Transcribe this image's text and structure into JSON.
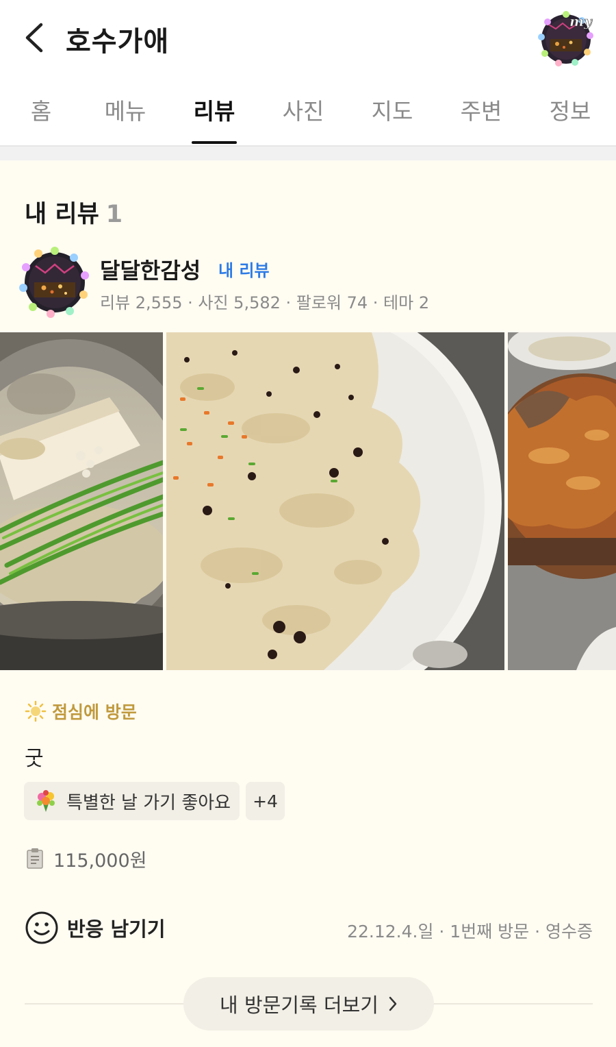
{
  "header": {
    "title": "호수가애",
    "back_icon": "chevron-left-icon",
    "profile_badge_text": "my"
  },
  "tabs": [
    {
      "label": "홈",
      "active": false
    },
    {
      "label": "메뉴",
      "active": false
    },
    {
      "label": "리뷰",
      "active": true
    },
    {
      "label": "사진",
      "active": false
    },
    {
      "label": "지도",
      "active": false
    },
    {
      "label": "주변",
      "active": false
    },
    {
      "label": "정보",
      "active": false
    }
  ],
  "section": {
    "title": "내 리뷰",
    "count": "1"
  },
  "reviewer": {
    "name": "달달한감성",
    "badge": "내 리뷰",
    "stats": "리뷰 2,555 · 사진 5,582 · 팔로워 74 · 테마 2"
  },
  "review": {
    "visit_time": "점심에 방문",
    "text": "굿",
    "tag": "특별한 날 가기 좋아요",
    "more_tags": "+4",
    "price": "115,000원",
    "reaction_label": "반응 남기기",
    "visit_meta": "22.12.4.일 · 1번째 방문 · 영수증"
  },
  "footer": {
    "more_visits": "내 방문기록 더보기"
  },
  "colors": {
    "background": "#fffcf2",
    "accent_blue": "#2c7be5",
    "visit_gold": "#c09a3e",
    "chip_bg": "#f2efe6"
  }
}
